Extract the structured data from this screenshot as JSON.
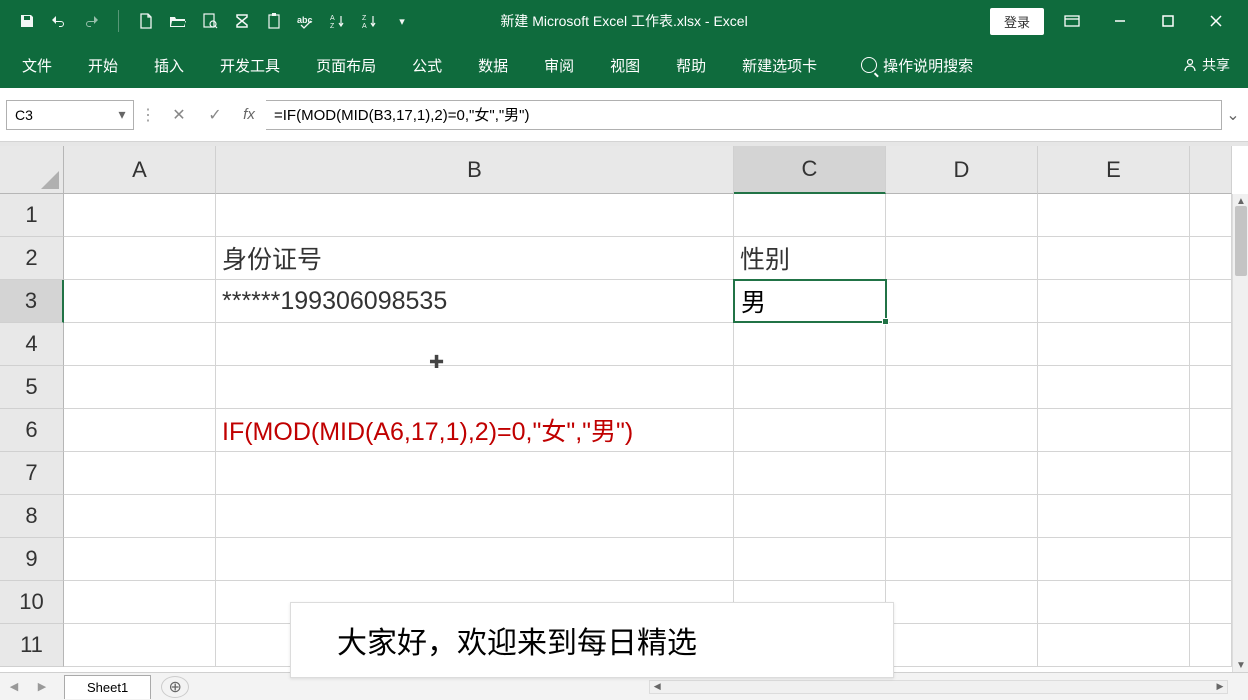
{
  "titlebar": {
    "title": "新建 Microsoft Excel 工作表.xlsx - Excel",
    "login_label": "登录"
  },
  "ribbon": {
    "tabs": [
      "文件",
      "开始",
      "插入",
      "开发工具",
      "页面布局",
      "公式",
      "数据",
      "审阅",
      "视图",
      "帮助",
      "新建选项卡"
    ],
    "tell_me": "操作说明搜索",
    "share_label": "共享"
  },
  "formula_bar": {
    "name_box": "C3",
    "formula": "=IF(MOD(MID(B3,17,1),2)=0,\"女\",\"男\")"
  },
  "columns": {
    "a": "A",
    "b": "B",
    "c": "C",
    "d": "D",
    "e": "E"
  },
  "rows": [
    "1",
    "2",
    "3",
    "4",
    "5",
    "6",
    "7",
    "8",
    "9",
    "10",
    "11"
  ],
  "cells": {
    "b2": "身份证号",
    "b3": "******199306098535",
    "b6": "IF(MOD(MID(A6,17,1),2)=0,\"女\",\"男\")",
    "c2": "性别",
    "c3": "男"
  },
  "sheet": {
    "tab_name": "Sheet1"
  },
  "subtitle": "大家好，欢迎来到每日精选"
}
